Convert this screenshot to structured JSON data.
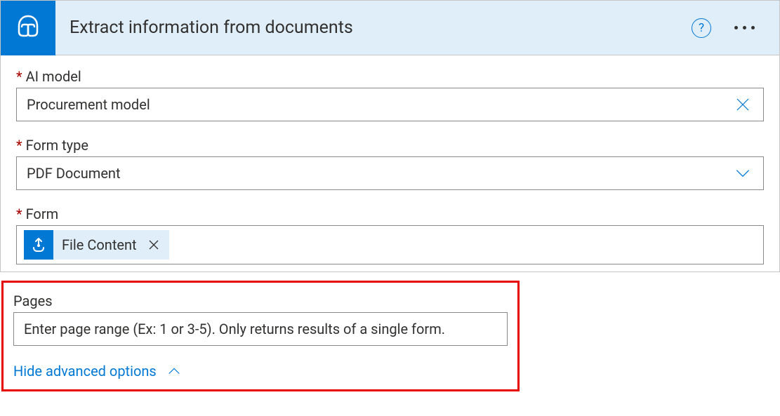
{
  "header": {
    "title": "Extract information from documents",
    "help_label": "?"
  },
  "fields": {
    "ai_model": {
      "label": "AI model",
      "value": "Procurement model"
    },
    "form_type": {
      "label": "Form type",
      "value": "PDF Document"
    },
    "form": {
      "label": "Form",
      "token_label": "File Content"
    },
    "pages": {
      "label": "Pages",
      "placeholder": "Enter page range (Ex: 1 or 3-5). Only returns results of a single form."
    }
  },
  "advanced": {
    "toggle_label": "Hide advanced options"
  }
}
